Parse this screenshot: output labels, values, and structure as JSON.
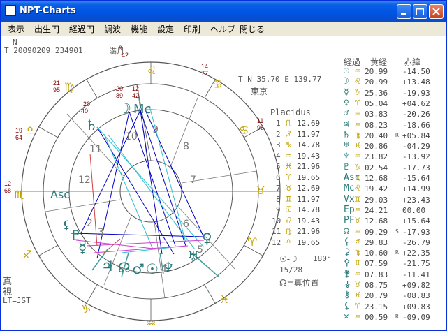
{
  "window": {
    "title": "NPT-Charts"
  },
  "menu": [
    "表示",
    "出生円",
    "経過円",
    "調波",
    "機能",
    "設定",
    "印刷",
    "ヘルプ",
    "閉じる"
  ],
  "header": {
    "line1": "N",
    "line2": "T 20090209 234901",
    "moon_label": "満月",
    "coords": "T N  35.70 E 139.77",
    "place": "東京"
  },
  "ring_labels": [
    {
      "num": "9",
      "deg": "42",
      "sign": "♌"
    },
    {
      "num": "14",
      "deg": "77",
      "sign": "♍"
    },
    {
      "num": "21",
      "deg": "95",
      "sign": "♍"
    },
    {
      "num": "20",
      "deg": "40",
      "sign": "♍"
    },
    {
      "num": "19",
      "deg": "64",
      "sign": "♎"
    },
    {
      "num": "12",
      "deg": "68",
      "sign": "♏"
    },
    {
      "num": "29",
      "deg": "83",
      "sign": "♏"
    },
    {
      "num": "20",
      "deg": "54",
      "sign": "♐"
    },
    {
      "num": "11",
      "deg": "96",
      "sign": "♐"
    },
    {
      "num": "14",
      "deg": "77",
      "sign": "♑"
    },
    {
      "num": "9",
      "deg": "42",
      "sign": "♒"
    },
    {
      "num": "21",
      "deg": "95",
      "sign": "♓"
    },
    {
      "num": "20",
      "deg": "86",
      "sign": "♈"
    },
    {
      "num": "11",
      "deg": "96",
      "sign": "♊"
    },
    {
      "num": "19",
      "deg": "64",
      "sign": "♋"
    },
    {
      "num": "12",
      "deg": "68",
      "sign": "♉"
    },
    {
      "num": "20",
      "deg": "89",
      "sign": "♈"
    },
    {
      "num": "12",
      "deg": "12",
      "sign": "♋"
    }
  ],
  "house_numbers": [
    "1",
    "2",
    "3",
    "4",
    "5",
    "6",
    "7",
    "8",
    "9",
    "10",
    "11",
    "12"
  ],
  "placidus": {
    "title": "Placidus",
    "rows": [
      {
        "n": "1",
        "sign": "♏",
        "v": "12.69"
      },
      {
        "n": "2",
        "sign": "♐",
        "v": "11.97"
      },
      {
        "n": "3",
        "sign": "♑",
        "v": "14.78"
      },
      {
        "n": "4",
        "sign": "♒",
        "v": "19.43"
      },
      {
        "n": "5",
        "sign": "♓",
        "v": "21.96"
      },
      {
        "n": "6",
        "sign": "♈",
        "v": "19.65"
      },
      {
        "n": "7",
        "sign": "♉",
        "v": "12.69"
      },
      {
        "n": "8",
        "sign": "♊",
        "v": "11.97"
      },
      {
        "n": "9",
        "sign": "♋",
        "v": "14.78"
      },
      {
        "n": "10",
        "sign": "♌",
        "v": "19.43"
      },
      {
        "n": "11",
        "sign": "♍",
        "v": "21.96"
      },
      {
        "n": "12",
        "sign": "♎",
        "v": "19.65"
      }
    ]
  },
  "transit": {
    "headers": [
      "経過",
      "黄経",
      "赤緯"
    ],
    "rows": [
      {
        "p": "☉",
        "sign": "♒",
        "lon": "20.99",
        "r": "",
        "dec": "-14.50"
      },
      {
        "p": "☽",
        "sign": "♌",
        "lon": "20.99",
        "r": "",
        "dec": "+13.48"
      },
      {
        "p": "☿",
        "sign": "♑",
        "lon": "25.36",
        "r": "",
        "dec": "-19.93"
      },
      {
        "p": "♀",
        "sign": "♈",
        "lon": "05.04",
        "r": "",
        "dec": "+04.62"
      },
      {
        "p": "♂",
        "sign": "♒",
        "lon": "03.83",
        "r": "",
        "dec": "-20.26"
      },
      {
        "p": "♃",
        "sign": "♒",
        "lon": "08.23",
        "r": "",
        "dec": "-18.66"
      },
      {
        "p": "♄",
        "sign": "♍",
        "lon": "20.40",
        "r": "R",
        "dec": "+05.84"
      },
      {
        "p": "♅",
        "sign": "♓",
        "lon": "20.86",
        "r": "",
        "dec": "-04.29"
      },
      {
        "p": "♆",
        "sign": "♒",
        "lon": "23.82",
        "r": "",
        "dec": "-13.92"
      },
      {
        "p": "♇",
        "sign": "♑",
        "lon": "02.54",
        "r": "",
        "dec": "-17.73"
      },
      {
        "p": "Asc",
        "sign": "♏",
        "lon": "12.68",
        "r": "",
        "dec": "-15.64"
      },
      {
        "p": "Mc",
        "sign": "♌",
        "lon": "19.42",
        "r": "",
        "dec": "+14.99"
      },
      {
        "p": "Vx",
        "sign": "♊",
        "lon": "29.03",
        "r": "",
        "dec": "+23.43"
      },
      {
        "p": "Ep",
        "sign": "♒",
        "lon": "24.21",
        "r": "",
        "dec": "00.00"
      },
      {
        "p": "PF",
        "sign": "♉",
        "lon": "12.68",
        "r": "",
        "dec": "+15.64"
      },
      {
        "p": "☊",
        "sign": "♒",
        "lon": "09.29",
        "r": "S",
        "dec": "-17.93"
      },
      {
        "p": "⚸",
        "sign": "♐",
        "lon": "29.83",
        "r": "",
        "dec": "-26.79"
      },
      {
        "p": "⚳",
        "sign": "♍",
        "lon": "10.60",
        "r": "R",
        "dec": "+22.35"
      },
      {
        "p": "⚴",
        "sign": "♊",
        "lon": "07.59",
        "r": "",
        "dec": "-21.75"
      },
      {
        "p": "⚵",
        "sign": "♒",
        "lon": "07.83",
        "r": "",
        "dec": "-11.41"
      },
      {
        "p": "⚶",
        "sign": "♉",
        "lon": "08.75",
        "r": "",
        "dec": "+09.82"
      },
      {
        "p": "⚷",
        "sign": "♓",
        "lon": "20.79",
        "r": "",
        "dec": "-08.83"
      },
      {
        "p": "⚸",
        "sign": "♈",
        "lon": "23.15",
        "r": "",
        "dec": "+09.83"
      },
      {
        "p": "✕",
        "sign": "♒",
        "lon": "00.59",
        "r": "R",
        "dec": "-09.09"
      }
    ]
  },
  "bottom_left": {
    "l1": "真",
    "l2": "視",
    "l3": "LT=JST"
  },
  "phase": {
    "symbols": "☉-☽",
    "deg": "180°",
    "frac": "15/28",
    "node": "☊=真位置"
  },
  "colors": {
    "accent": "#0000c0",
    "maroon": "#800000",
    "cyan": "#40c0c0",
    "magenta": "#d040d0",
    "red": "#d04040",
    "green": "#208080",
    "olive": "#c0a000"
  }
}
